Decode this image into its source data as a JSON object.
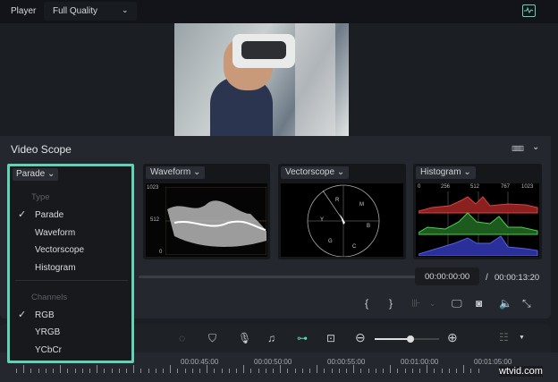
{
  "topbar": {
    "player_label": "Player",
    "quality": "Full Quality",
    "scope_toggle_icon": "waveform-monitor-icon"
  },
  "scope": {
    "title": "Video Scope",
    "layout_icon": "layout-grid-icon",
    "cards": [
      {
        "type": "Parade"
      },
      {
        "type": "Waveform",
        "axis": [
          "1023",
          "512",
          "0"
        ]
      },
      {
        "type": "Vectorscope",
        "targets": [
          "R",
          "M",
          "Y",
          "B",
          "G",
          "C"
        ]
      },
      {
        "type": "Histogram",
        "axis": [
          "0",
          "256",
          "512",
          "767",
          "1023"
        ]
      }
    ]
  },
  "menu": {
    "type_header": "Type",
    "types": [
      "Parade",
      "Waveform",
      "Vectorscope",
      "Histogram"
    ],
    "selected_type": "Parade",
    "channels_header": "Channels",
    "channels": [
      "RGB",
      "YRGB",
      "YCbCr"
    ],
    "selected_channel": "RGB"
  },
  "playback": {
    "current_time": "00:00:00:00",
    "separator": "/",
    "total_time": "00:00:13:20"
  },
  "timeline": {
    "zoom_level": 0.55,
    "ruler_labels": [
      "00:00:45:00",
      "00:00:50:00",
      "00:00:55:00",
      "00:01:00:00",
      "00:01:05:00"
    ]
  },
  "colors": {
    "accent": "#5fd3b3",
    "red": "#d33a3a",
    "green": "#3fae3f",
    "blue": "#3a45c8"
  },
  "watermark": "wtvid.com"
}
